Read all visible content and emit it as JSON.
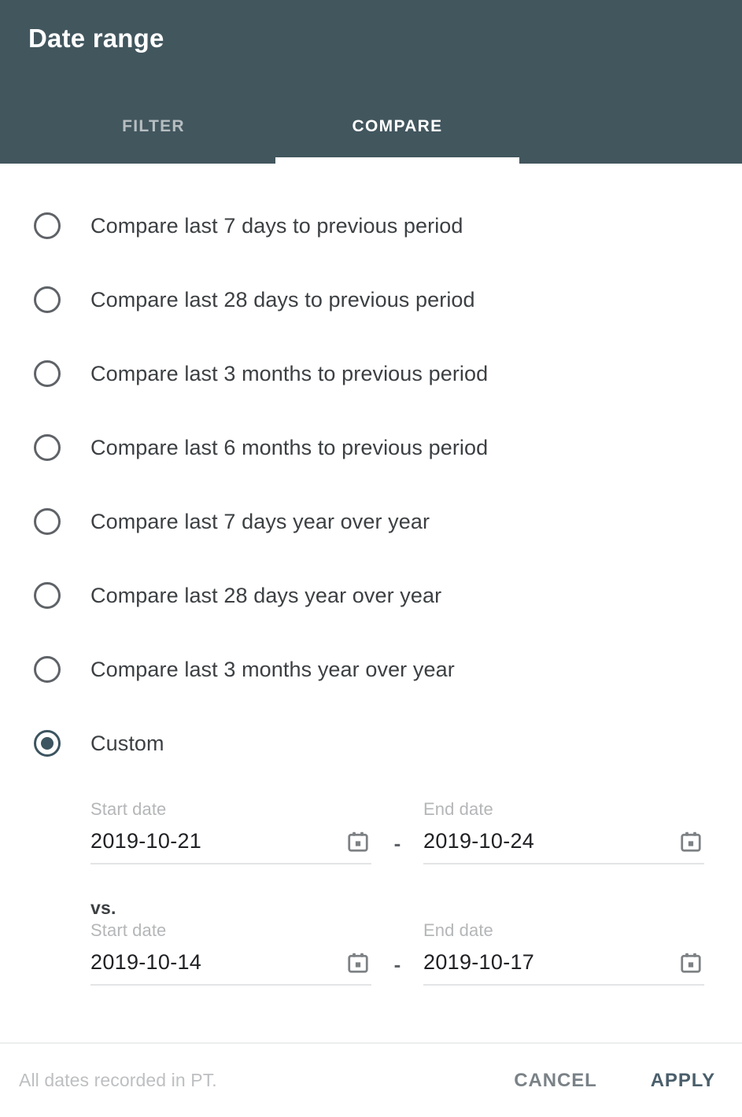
{
  "header": {
    "title": "Date range",
    "tabs": [
      {
        "label": "FILTER",
        "active": false
      },
      {
        "label": "COMPARE",
        "active": true
      }
    ]
  },
  "options": [
    {
      "label": "Compare last 7 days to previous period",
      "selected": false
    },
    {
      "label": "Compare last 28 days to previous period",
      "selected": false
    },
    {
      "label": "Compare last 3 months to previous period",
      "selected": false
    },
    {
      "label": "Compare last 6 months to previous period",
      "selected": false
    },
    {
      "label": "Compare last 7 days year over year",
      "selected": false
    },
    {
      "label": "Compare last 28 days year over year",
      "selected": false
    },
    {
      "label": "Compare last 3 months year over year",
      "selected": false
    },
    {
      "label": "Custom",
      "selected": true
    }
  ],
  "custom": {
    "primary": {
      "start_label": "Start date",
      "start_value": "2019-10-21",
      "separator": "-",
      "end_label": "End date",
      "end_value": "2019-10-24"
    },
    "vs_label": "vs.",
    "comparison": {
      "start_label": "Start date",
      "start_value": "2019-10-14",
      "separator": "-",
      "end_label": "End date",
      "end_value": "2019-10-17"
    }
  },
  "footer": {
    "note": "All dates recorded in PT.",
    "cancel_label": "CANCEL",
    "apply_label": "APPLY"
  },
  "colors": {
    "header_bg": "#42565E",
    "accent": "#3C5560",
    "apply": "#4A5F6B",
    "text": "#3C4043",
    "muted": "#B4B6B8"
  }
}
